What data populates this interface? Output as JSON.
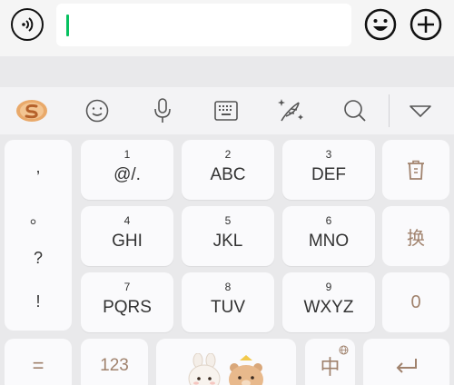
{
  "chat": {
    "voice_icon": "voice-icon",
    "emoji_icon": "emoji-icon",
    "plus_icon": "plus-icon"
  },
  "toolbar": {
    "items": [
      "sogou-logo-icon",
      "emoji-icon",
      "microphone-icon",
      "keyboard-icon",
      "handwriting-icon",
      "search-icon",
      "collapse-icon"
    ]
  },
  "punctuation": [
    ",",
    "。",
    "?",
    "!"
  ],
  "keys": [
    {
      "num": "1",
      "letters": "@/."
    },
    {
      "num": "2",
      "letters": "ABC"
    },
    {
      "num": "3",
      "letters": "DEF"
    },
    {
      "num": "4",
      "letters": "GHI"
    },
    {
      "num": "5",
      "letters": "JKL"
    },
    {
      "num": "6",
      "letters": "MNO"
    },
    {
      "num": "7",
      "letters": "PQRS"
    },
    {
      "num": "8",
      "letters": "TUV"
    },
    {
      "num": "9",
      "letters": "WXYZ"
    }
  ],
  "side": {
    "delete_icon": "delete-icon",
    "switch_label": "换",
    "zero_label": "0"
  },
  "bottom": {
    "symbol_label": "=",
    "num_label": "123",
    "lang_label": "中",
    "enter_icon": "enter-icon"
  },
  "colors": {
    "accent_cursor": "#07c160",
    "function_key_text": "#a0826d"
  }
}
